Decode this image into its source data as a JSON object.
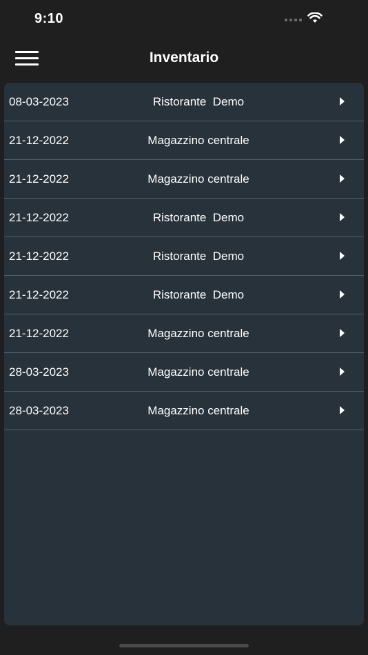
{
  "status_bar": {
    "time": "9:10",
    "icons": [
      "signal-dots-icon",
      "wifi-icon"
    ]
  },
  "nav": {
    "title": "Inventario",
    "menu_icon": "hamburger-menu-icon"
  },
  "colors": {
    "background": "#1f1f1f",
    "panel": "#28323a",
    "divider": "#53606a",
    "text": "#ffffff"
  },
  "list": {
    "items": [
      {
        "date": "08-03-2023",
        "location": "Ristorante  Demo"
      },
      {
        "date": "21-12-2022",
        "location": "Magazzino centrale"
      },
      {
        "date": "21-12-2022",
        "location": "Magazzino centrale"
      },
      {
        "date": "21-12-2022",
        "location": "Ristorante  Demo"
      },
      {
        "date": "21-12-2022",
        "location": "Ristorante  Demo"
      },
      {
        "date": "21-12-2022",
        "location": "Ristorante  Demo"
      },
      {
        "date": "21-12-2022",
        "location": "Magazzino centrale"
      },
      {
        "date": "28-03-2023",
        "location": "Magazzino centrale"
      },
      {
        "date": "28-03-2023",
        "location": "Magazzino centrale"
      }
    ]
  }
}
